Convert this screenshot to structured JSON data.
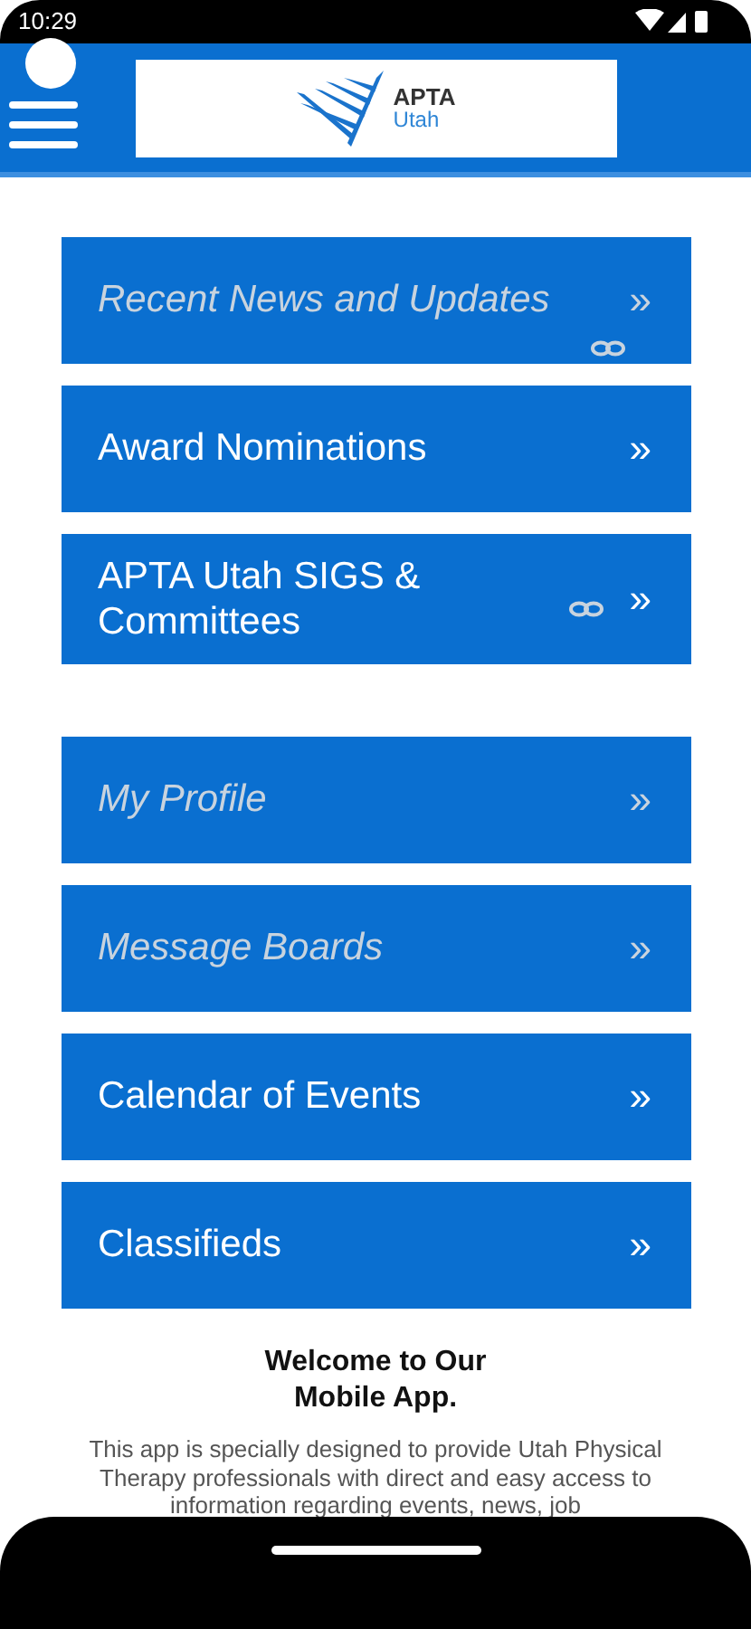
{
  "status_bar": {
    "time": "10:29"
  },
  "header": {
    "logo_text": [
      "APTA",
      "Utah"
    ]
  },
  "menu": [
    {
      "label": "Recent News and Updates",
      "arrow": "»",
      "dimmed": true,
      "link": true
    },
    {
      "label": "Award Nominations",
      "arrow": "»",
      "dimmed": false,
      "link": false
    },
    {
      "label": "APTA Utah SIGS & Committees",
      "arrow": "»",
      "dimmed": false,
      "link": true
    },
    {
      "label": "My Profile",
      "arrow": "»",
      "dimmed": true,
      "link": false
    },
    {
      "label": "Message Boards",
      "arrow": "»",
      "dimmed": true,
      "link": false
    },
    {
      "label": "Calendar of Events",
      "arrow": "»",
      "dimmed": false,
      "link": false
    },
    {
      "label": "Classifieds",
      "arrow": "»",
      "dimmed": false,
      "link": false
    }
  ],
  "welcome": {
    "title": "Welcome to Our Mobile App.",
    "text": "This app is specially designed to provide Utah Physical Therapy professionals with direct and easy access to information regarding events, news, job"
  }
}
